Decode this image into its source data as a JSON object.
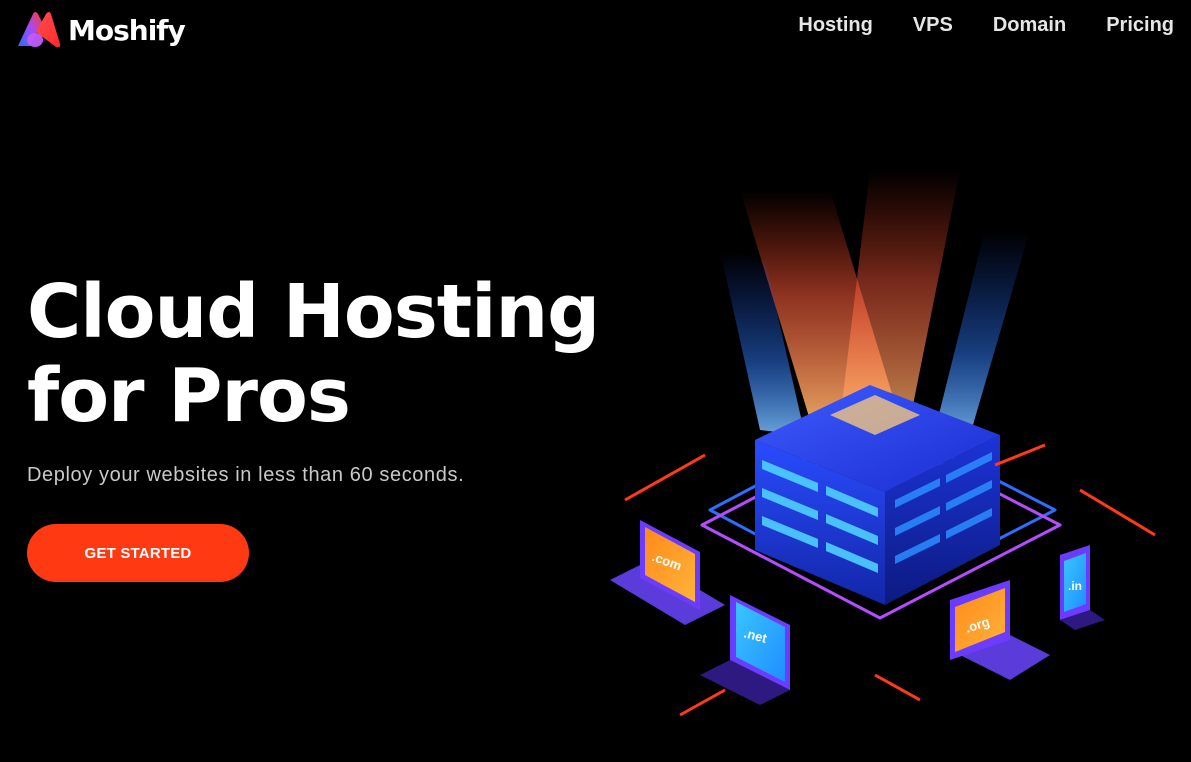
{
  "brand": {
    "name": "Moshify",
    "logo_icon": "moshify-logo-icon"
  },
  "nav": {
    "items": [
      {
        "label": "Hosting"
      },
      {
        "label": "VPS"
      },
      {
        "label": "Domain"
      },
      {
        "label": "Pricing"
      }
    ]
  },
  "hero": {
    "title_line1": "Cloud Hosting",
    "title_line2": "for Pros",
    "subtitle": "Deploy your websites in less than 60 seconds.",
    "cta_label": "GET STARTED"
  },
  "illustration": {
    "devices": [
      {
        "label": ".com"
      },
      {
        "label": ".net"
      },
      {
        "label": ".org"
      },
      {
        "label": ".in"
      }
    ]
  },
  "colors": {
    "background": "#000000",
    "accent": "#ff3a12",
    "server_blue": "#1e3cff",
    "ring_purple": "#b44dff",
    "ring_blue": "#2f6dff"
  }
}
